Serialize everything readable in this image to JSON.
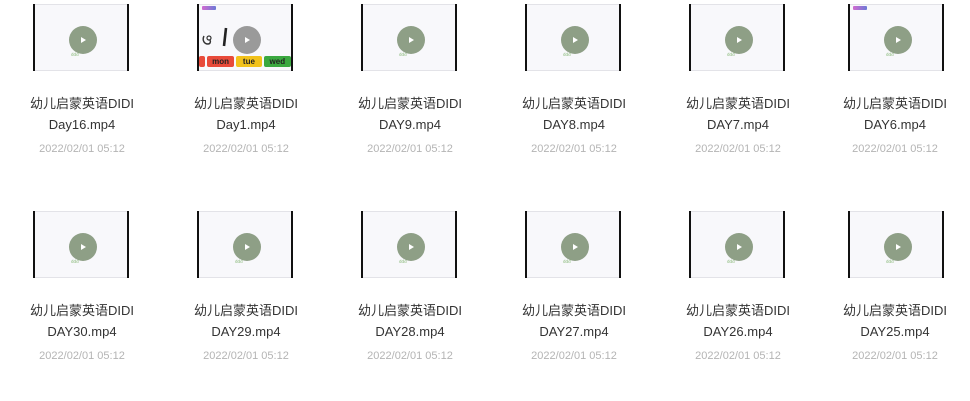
{
  "files": [
    {
      "name_line1": "幼儿启蒙英语DIDI",
      "name_line2": "Day16.mp4",
      "date": "2022/02/01 05:12",
      "thumbnail": "play-thumb"
    },
    {
      "name_line1": "幼儿启蒙英语DIDI",
      "name_line2": "Day1.mp4",
      "date": "2022/02/01 05:12",
      "thumbnail": "days-of-week-thumb",
      "thumb_chips": [
        "mon",
        "tue",
        "wed"
      ]
    },
    {
      "name_line1": "幼儿启蒙英语DIDI",
      "name_line2": "DAY9.mp4",
      "date": "2022/02/01 05:12",
      "thumbnail": "play-thumb"
    },
    {
      "name_line1": "幼儿启蒙英语DIDI",
      "name_line2": "DAY8.mp4",
      "date": "2022/02/01 05:12",
      "thumbnail": "play-thumb"
    },
    {
      "name_line1": "幼儿启蒙英语DIDI",
      "name_line2": "DAY7.mp4",
      "date": "2022/02/01 05:12",
      "thumbnail": "play-thumb"
    },
    {
      "name_line1": "幼儿启蒙英语DIDI",
      "name_line2": "DAY6.mp4",
      "date": "2022/02/01 05:12",
      "thumbnail": "play-thumb-logo"
    },
    {
      "name_line1": "幼儿启蒙英语DIDI",
      "name_line2": "DAY30.mp4",
      "date": "2022/02/01 05:12",
      "thumbnail": "play-thumb"
    },
    {
      "name_line1": "幼儿启蒙英语DIDI",
      "name_line2": "DAY29.mp4",
      "date": "2022/02/01 05:12",
      "thumbnail": "play-thumb"
    },
    {
      "name_line1": "幼儿启蒙英语DIDI",
      "name_line2": "DAY28.mp4",
      "date": "2022/02/01 05:12",
      "thumbnail": "play-thumb"
    },
    {
      "name_line1": "幼儿启蒙英语DIDI",
      "name_line2": "DAY27.mp4",
      "date": "2022/02/01 05:12",
      "thumbnail": "play-thumb"
    },
    {
      "name_line1": "幼儿启蒙英语DIDI",
      "name_line2": "DAY26.mp4",
      "date": "2022/02/01 05:12",
      "thumbnail": "play-thumb"
    },
    {
      "name_line1": "幼儿启蒙英语DIDI",
      "name_line2": "DAY25.mp4",
      "date": "2022/02/01 05:12",
      "thumbnail": "play-thumb"
    }
  ],
  "colors": {
    "play_button": "#8e9f86",
    "title_text": "#333333",
    "date_text": "#b4b4b4",
    "chip_mon": "#e84a3a",
    "chip_tue": "#f2c21b",
    "chip_wed": "#3aa83f"
  },
  "icons": {
    "play": "play-icon"
  }
}
